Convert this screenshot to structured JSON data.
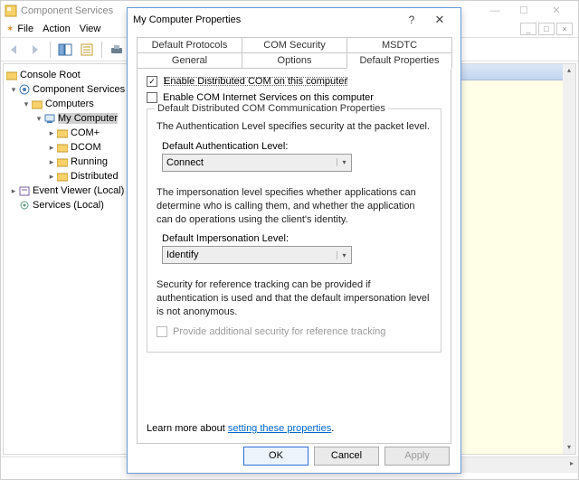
{
  "main_window": {
    "title": "Component Services",
    "menu": [
      "File",
      "Action",
      "View"
    ],
    "mdi_controls": [
      "_",
      "□",
      "×"
    ]
  },
  "tree": {
    "root": "Console Root",
    "items": [
      "Component Services",
      "Computers",
      "My Computer",
      "COM+",
      "DCOM",
      "Running",
      "Distributed",
      "Event Viewer (Local)",
      "Services (Local)"
    ]
  },
  "dialog": {
    "title": "My Computer Properties",
    "tabs_row1": [
      "Default Protocols",
      "COM Security",
      "MSDTC"
    ],
    "tabs_row2": [
      "General",
      "Options",
      "Default Properties"
    ],
    "active_tab": "Default Properties",
    "chk_dcom": {
      "checked": true,
      "label": "Enable Distributed COM on this computer"
    },
    "chk_cis": {
      "checked": false,
      "label": "Enable COM Internet Services on this computer"
    },
    "group_title": "Default Distributed COM Communication Properties",
    "auth_desc": "The Authentication Level specifies security at the packet level.",
    "auth_label": "Default Authentication Level:",
    "auth_value": "Connect",
    "imp_desc": "The impersonation level specifies whether applications can determine who is calling them, and whether the application can do operations using the client's identity.",
    "imp_label": "Default Impersonation Level:",
    "imp_value": "Identify",
    "sec_desc": "Security for reference tracking can be provided if authentication is used and that the default impersonation level is not anonymous.",
    "chk_ref": {
      "checked": false,
      "label": "Provide additional security for reference tracking",
      "disabled": true
    },
    "learn_prefix": "Learn more about ",
    "learn_link": "setting these properties",
    "buttons": {
      "ok": "OK",
      "cancel": "Cancel",
      "apply": "Apply"
    }
  }
}
